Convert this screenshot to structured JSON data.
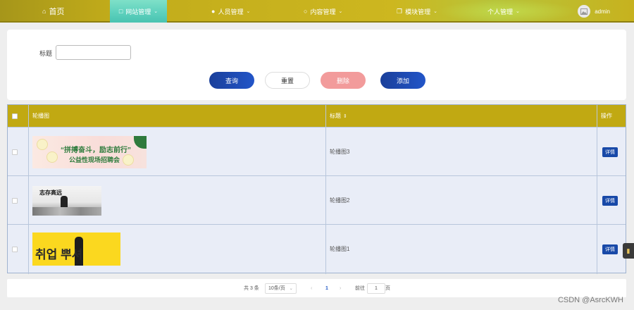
{
  "nav": {
    "home": "首页",
    "items": [
      {
        "label": "网站管理",
        "icon": "monitor-icon",
        "active": true
      },
      {
        "label": "人员管理",
        "icon": "user-icon"
      },
      {
        "label": "内容管理",
        "icon": "chat-icon"
      },
      {
        "label": "模块管理",
        "icon": "copy-icon"
      },
      {
        "label": "个人管理",
        "icon": ""
      }
    ],
    "user": "admin"
  },
  "search": {
    "title_label": "标题",
    "title_value": "",
    "buttons": {
      "query": "查询",
      "reset": "重置",
      "delete": "删除",
      "add": "添加"
    }
  },
  "table": {
    "headers": {
      "image": "轮播图",
      "title": "标题",
      "action": "操作"
    },
    "rows": [
      {
        "title": "轮播图3",
        "detail": "详情",
        "image_text_1": "“拼搏奋斗，励志前行”",
        "image_text_2": "公益性现场招聘会"
      },
      {
        "title": "轮播图2",
        "detail": "详情",
        "image_text_1": "志存高远"
      },
      {
        "title": "轮播图1",
        "detail": "详情",
        "image_text_1": "취업 뿌셔"
      }
    ]
  },
  "pagination": {
    "total": "共 3 条",
    "page_size": "10条/页",
    "current_page": "1",
    "goto_label": "前往",
    "goto_value": "1",
    "page_unit": "页"
  },
  "watermark": "CSDN @AsrcKWH",
  "colors": {
    "header": "#c1a912",
    "accent": "#1849a8",
    "danger": "#f29b9b",
    "active_nav": "#5ed1bd"
  }
}
